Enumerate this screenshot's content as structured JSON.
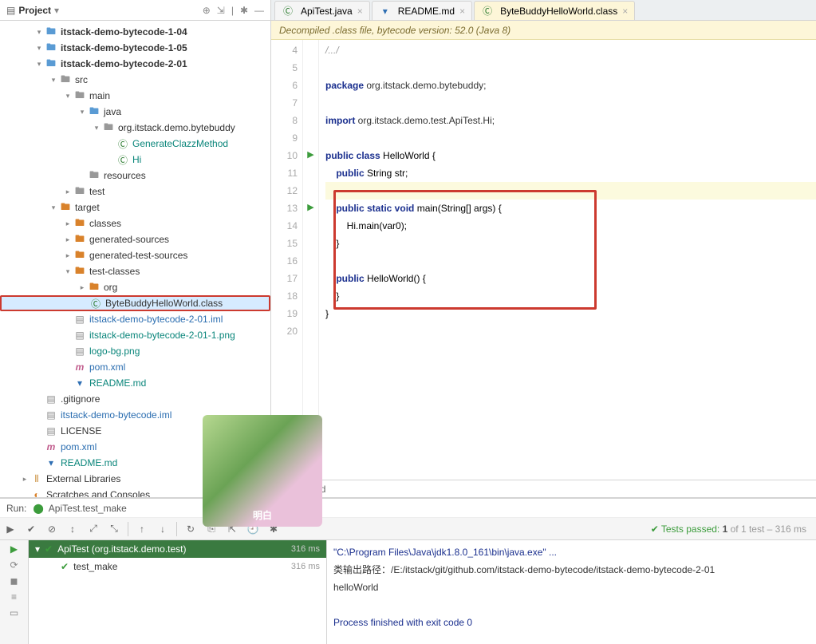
{
  "project_header": {
    "title": "Project"
  },
  "tree": [
    {
      "depth": 0,
      "chev": "▾",
      "icon": "folder-blue",
      "label": "itstack-demo-bytecode-1-04",
      "bold": true
    },
    {
      "depth": 0,
      "chev": "▾",
      "icon": "folder-blue",
      "label": "itstack-demo-bytecode-1-05",
      "bold": true
    },
    {
      "depth": 0,
      "chev": "▾",
      "icon": "folder-blue",
      "label": "itstack-demo-bytecode-2-01",
      "bold": true
    },
    {
      "depth": 1,
      "chev": "▾",
      "icon": "folder-gray",
      "label": "src"
    },
    {
      "depth": 2,
      "chev": "▾",
      "icon": "folder-gray",
      "label": "main"
    },
    {
      "depth": 3,
      "chev": "▾",
      "icon": "folder-blue",
      "label": "java"
    },
    {
      "depth": 4,
      "chev": "▾",
      "icon": "folder-gray",
      "label": "org.itstack.demo.bytebuddy"
    },
    {
      "depth": 5,
      "chev": "",
      "icon": "class",
      "label": "GenerateClazzMethod",
      "cls": "teal"
    },
    {
      "depth": 5,
      "chev": "",
      "icon": "class",
      "label": "Hi",
      "cls": "teal"
    },
    {
      "depth": 3,
      "chev": "",
      "icon": "folder-gray",
      "label": "resources"
    },
    {
      "depth": 2,
      "chev": "▸",
      "icon": "folder-gray",
      "label": "test"
    },
    {
      "depth": 1,
      "chev": "▾",
      "icon": "folder-orange",
      "label": "target"
    },
    {
      "depth": 2,
      "chev": "▸",
      "icon": "folder-orange",
      "label": "classes"
    },
    {
      "depth": 2,
      "chev": "▸",
      "icon": "folder-orange",
      "label": "generated-sources"
    },
    {
      "depth": 2,
      "chev": "▸",
      "icon": "folder-orange",
      "label": "generated-test-sources"
    },
    {
      "depth": 2,
      "chev": "▾",
      "icon": "folder-orange",
      "label": "test-classes"
    },
    {
      "depth": 3,
      "chev": "▸",
      "icon": "folder-orange",
      "label": "org"
    },
    {
      "depth": 3,
      "chev": "",
      "icon": "class",
      "label": "ByteBuddyHelloWorld.class",
      "selected": true
    },
    {
      "depth": 2,
      "chev": "",
      "icon": "file",
      "label": "itstack-demo-bytecode-2-01.iml",
      "cls": "blue"
    },
    {
      "depth": 2,
      "chev": "",
      "icon": "file",
      "label": "itstack-demo-bytecode-2-01-1.png",
      "cls": "teal"
    },
    {
      "depth": 2,
      "chev": "",
      "icon": "file",
      "label": "logo-bg.png",
      "cls": "teal"
    },
    {
      "depth": 2,
      "chev": "",
      "icon": "maven",
      "label": "pom.xml",
      "cls": "blue"
    },
    {
      "depth": 2,
      "chev": "",
      "icon": "md",
      "label": "README.md",
      "cls": "teal"
    },
    {
      "depth": 0,
      "chev": "",
      "icon": "file",
      "label": ".gitignore"
    },
    {
      "depth": 0,
      "chev": "",
      "icon": "file",
      "label": "itstack-demo-bytecode.iml",
      "cls": "blue"
    },
    {
      "depth": 0,
      "chev": "",
      "icon": "file",
      "label": "LICENSE"
    },
    {
      "depth": 0,
      "chev": "",
      "icon": "maven",
      "label": "pom.xml",
      "cls": "blue"
    },
    {
      "depth": 0,
      "chev": "",
      "icon": "md",
      "label": "README.md",
      "cls": "teal"
    },
    {
      "depth": -1,
      "chev": "▸",
      "icon": "lib",
      "label": "External Libraries"
    },
    {
      "depth": -1,
      "chev": "",
      "icon": "scratch",
      "label": "Scratches and Consoles"
    }
  ],
  "tabs": [
    {
      "icon": "class",
      "label": "ApiTest.java",
      "active": false
    },
    {
      "icon": "md",
      "label": "README.md",
      "active": false
    },
    {
      "icon": "class",
      "label": "ByteBuddyHelloWorld.class",
      "active": true
    }
  ],
  "banner": "Decompiled .class file, bytecode version: 52.0 (Java 8)",
  "gutter": [
    "4",
    "5",
    "6",
    "7",
    "8",
    "9",
    "10",
    "11",
    "12",
    "13",
    "14",
    "15",
    "16",
    "17",
    "18",
    "19",
    "20"
  ],
  "code": {
    "l4": "/.../",
    "l6a": "package",
    "l6b": " org.itstack.demo.bytebuddy;",
    "l8a": "import",
    "l8b": " org.itstack.demo.test.ApiTest.Hi;",
    "l10a": "public class",
    "l10b": " HelloWorld {",
    "l11a": "    public",
    "l11b": " String str;",
    "l13a": "    public static void",
    "l13b": " main(String[] args) {",
    "l14": "        Hi.main(var0);",
    "l15": "    }",
    "l17a": "    public",
    "l17b": " HelloWorld() {",
    "l18": "    }",
    "l19": "}"
  },
  "breadcrumb": "HelloWorld",
  "overlay_caption": "明白",
  "run": {
    "header_label": "Run:",
    "header_name": "ApiTest.test_make",
    "status_prefix": "✔ Tests passed: ",
    "status_count": "1",
    "status_suffix": " of 1 test – 316 ms",
    "tree_header": "ApiTest (org.itstack.demo.test)",
    "tree_time": "316 ms",
    "tree_item": "test_make",
    "tree_item_time": "316 ms",
    "console_l1": "\"C:\\Program Files\\Java\\jdk1.8.0_161\\bin\\java.exe\" ...",
    "console_l2": "类输出路径：/E:/itstack/git/github.com/itstack-demo-bytecode/itstack-demo-bytecode-2-01",
    "console_l3": "helloWorld",
    "console_l5": "Process finished with exit code 0"
  }
}
